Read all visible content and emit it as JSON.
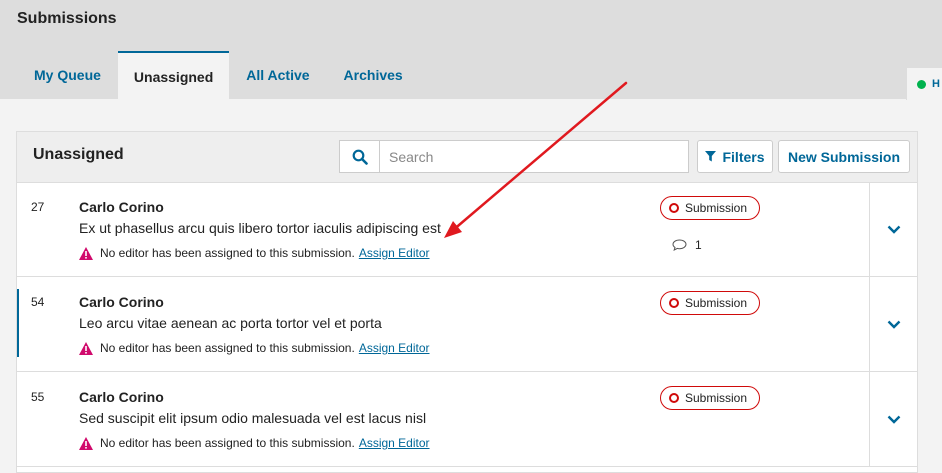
{
  "page": {
    "title": "Submissions"
  },
  "tabs": [
    {
      "label": "My Queue"
    },
    {
      "label": "Unassigned"
    },
    {
      "label": "All Active"
    },
    {
      "label": "Archives"
    }
  ],
  "help_tab": {
    "label": "H"
  },
  "panel": {
    "title": "Unassigned",
    "search_placeholder": "Search",
    "search_value": "",
    "filters_label": "Filters",
    "new_submission_label": "New Submission"
  },
  "submissions": [
    {
      "id": "27",
      "author": "Carlo Corino",
      "title": "Ex ut phasellus arcu quis libero tortor iaculis adipiscing est",
      "notice": "No editor has been assigned to this submission.",
      "assign_label": "Assign Editor",
      "stage": "Submission",
      "comments": "1"
    },
    {
      "id": "54",
      "author": "Carlo Corino",
      "title": "Leo arcu vitae aenean ac porta tortor vel et porta",
      "notice": "No editor has been assigned to this submission.",
      "assign_label": "Assign Editor",
      "stage": "Submission"
    },
    {
      "id": "55",
      "author": "Carlo Corino",
      "title": "Sed suscipit elit ipsum odio malesuada vel est lacus nisl",
      "notice": "No editor has been assigned to this submission.",
      "assign_label": "Assign Editor",
      "stage": "Submission"
    }
  ],
  "colors": {
    "link": "#006798",
    "stage_badge": "#d00a0a",
    "warning": "#d00a6c",
    "annotation_arrow": "#e0191f",
    "help_dot": "#00b24e"
  },
  "icons": {
    "search": "search-icon",
    "filter": "filter-icon",
    "warning": "warning-icon",
    "comment": "comment-icon",
    "expand": "chevron-down-icon"
  }
}
